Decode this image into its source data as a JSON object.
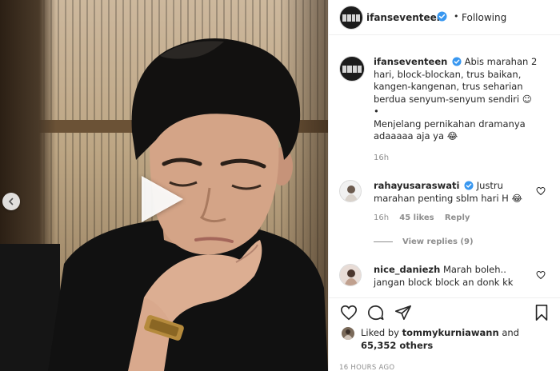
{
  "post": {
    "username": "ifanseventeen",
    "separator": "•",
    "follow_status": "Following"
  },
  "caption": {
    "username": "ifanseventeen",
    "line1": "Abis marahan 2 hari, block-blockan, trus baikan, kangen-kangenan, trus seharian berdua senyum-senyum sendiri ☺",
    "bullet": "•",
    "line2": "Menjelang pernikahan dramanya adaaaaa aja ya 😂",
    "time": "16h"
  },
  "comments": [
    {
      "username": "rahayusaraswati",
      "text": "Justru marahan penting sblm hari H 😂",
      "time": "16h",
      "likes": "45 likes",
      "reply_label": "Reply"
    },
    {
      "username": "nice_daniezh",
      "text": "Marah boleh.. jangan block block an donk kk",
      "time": "",
      "likes": "",
      "reply_label": ""
    }
  ],
  "view_replies": "View replies (9)",
  "likes": {
    "prefix": "Liked by",
    "user": "tommykurniawann",
    "and": "and",
    "others": "65,352 others"
  },
  "timestamp": "16 HOURS AGO",
  "icons": {
    "verified": "verified-badge-icon",
    "like": "heart-icon",
    "comment": "comment-icon",
    "share": "share-icon",
    "save": "bookmark-icon",
    "play": "play-icon",
    "prev": "chevron-left-icon"
  },
  "colors": {
    "verified": "#3897f0",
    "text": "#262626",
    "muted": "#8e8e8e",
    "border": "#efefef"
  }
}
